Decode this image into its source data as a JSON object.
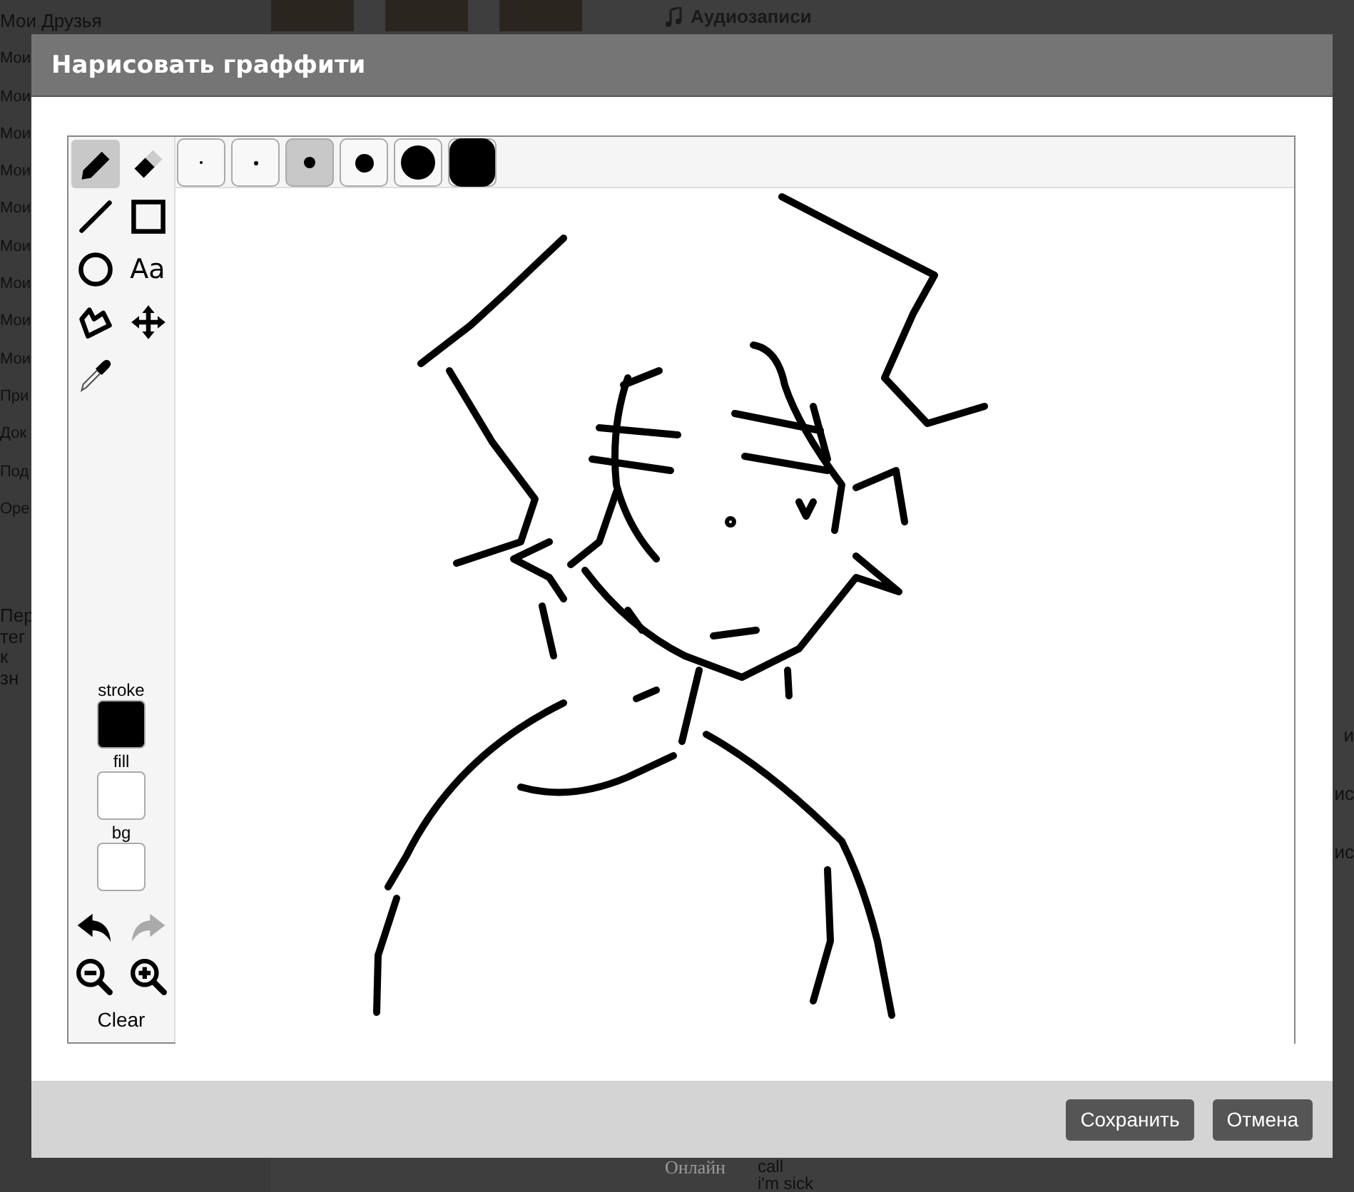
{
  "background_page": {
    "sidebar": [
      "Мои Друзья",
      "Мои",
      "Мои",
      "Мои",
      "Мои",
      "Мои",
      "Мои",
      "Мои",
      "Мои",
      "Мои",
      "При",
      "Док",
      "Под",
      "Оре"
    ],
    "sidebar_note": [
      "Пер",
      "тег",
      "к",
      "зн"
    ],
    "top_heading": "Аудиозаписи",
    "right_fragments": [
      "и",
      "ис",
      "ис"
    ],
    "bottom": {
      "status": "Онлайн",
      "messages": [
        "call",
        "i'm sick"
      ]
    }
  },
  "dialog": {
    "title": "Нарисовать граффити",
    "tools": [
      {
        "kind": "pencil",
        "selected": true
      },
      {
        "kind": "eraser",
        "selected": false
      },
      {
        "kind": "line",
        "selected": false
      },
      {
        "kind": "rectangle",
        "selected": false
      },
      {
        "kind": "ellipse",
        "selected": false
      },
      {
        "kind": "text",
        "label": "Aa",
        "selected": false
      },
      {
        "kind": "polygon",
        "selected": false
      },
      {
        "kind": "move",
        "selected": false
      },
      {
        "kind": "eyedropper",
        "selected": false
      }
    ],
    "brush_sizes": [
      {
        "kind": "xs",
        "selected": false
      },
      {
        "kind": "s",
        "selected": false
      },
      {
        "kind": "m",
        "selected": true
      },
      {
        "kind": "l",
        "selected": false
      },
      {
        "kind": "xl",
        "selected": false
      },
      {
        "kind": "xxl",
        "selected": false
      }
    ],
    "colors": [
      {
        "label": "stroke",
        "color": "#000000"
      },
      {
        "label": "fill",
        "color": "#ffffff"
      },
      {
        "label": "bg",
        "color": "#ffffff"
      }
    ],
    "history": [
      {
        "kind": "undo",
        "disabled": false
      },
      {
        "kind": "redo",
        "disabled": true
      }
    ],
    "zoom": [
      {
        "kind": "zoom_out"
      },
      {
        "kind": "zoom_in"
      }
    ],
    "clear": "Clear",
    "buttons": [
      "Сохранить",
      "Отмена"
    ]
  }
}
